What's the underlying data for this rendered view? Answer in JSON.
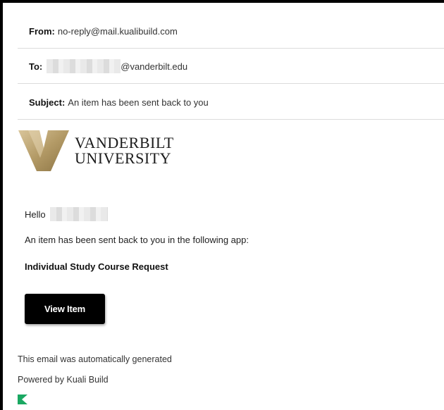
{
  "email": {
    "from_label": "From:",
    "from_value": "no-reply@mail.kualibuild.com",
    "to_label": "To:",
    "to_value": "@vanderbilt.edu",
    "subject_label": "Subject:",
    "subject_value": "An item has been sent back to you"
  },
  "logo": {
    "line1": "VANDERBILT",
    "line2": "UNIVERSITY",
    "mark_color": "#b5a072",
    "icon": "vanderbilt-v-logo"
  },
  "message": {
    "greeting": "Hello",
    "intro": "An item has been sent back to you in the following app:",
    "app_name": "Individual Study Course Request",
    "button_label": "View Item"
  },
  "footer": {
    "auto_generated": "This email was automatically generated",
    "powered_by": "Powered by Kuali Build",
    "icon": "kuali-logo",
    "icon_color": "#1aa862"
  }
}
